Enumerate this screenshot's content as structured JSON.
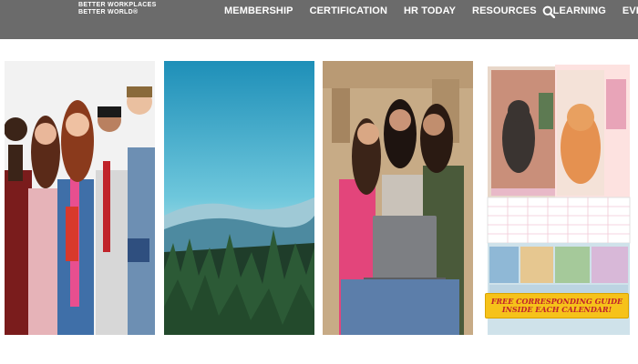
{
  "header": {
    "logo_line1": "BETTER WORKPLACES",
    "logo_line2": "BETTER WORLD®",
    "nav": [
      {
        "label": "MEMBERSHIP"
      },
      {
        "label": "CERTIFICATION"
      },
      {
        "label": "HR TODAY"
      },
      {
        "label": "RESOURCES"
      },
      {
        "label": "LEARNING"
      },
      {
        "label": "EVENTS"
      }
    ],
    "search_icon": "search-icon"
  },
  "cards": [
    {
      "subject": "group of smiling students"
    },
    {
      "subject": "forest and mountain landscape"
    },
    {
      "subject": "friends with laptop"
    },
    {
      "subject": "pet calendar product"
    }
  ],
  "promo": {
    "banner_text": "FREE CORRESPONDING GUIDE INSIDE EACH CALENDAR!"
  },
  "colors": {
    "header_bg": "#6b6b6b",
    "banner_bg": "#f6c21a",
    "banner_text": "#c0242b"
  }
}
